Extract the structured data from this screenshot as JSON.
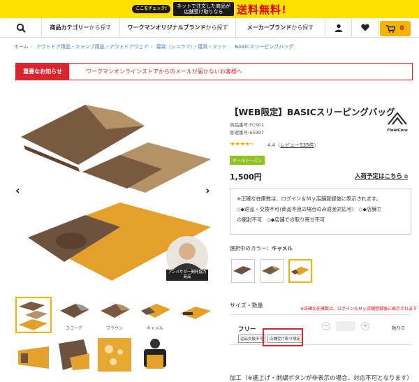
{
  "banner": {
    "check_label": "ここをチェック!",
    "middle_line1": "ネットで注文した商品が",
    "middle_line2": "店舗受け取りなら",
    "free_text": "送料無料!"
  },
  "nav": {
    "category": {
      "bold": "商品カテゴリー",
      "rest": "から探す"
    },
    "brand": {
      "bold": "ワークマンオリジナルブランド",
      "rest": "から探す"
    },
    "maker": {
      "bold": "メーカーブランド",
      "rest": "から探す"
    },
    "cart_count": "0"
  },
  "breadcrumb": [
    "ホーム",
    "アウトドア用品・キャンプ用品・アウトドアウェア",
    "寝袋（シュラフ）・寝具・マット",
    "BASICスリーピングバッグ"
  ],
  "notice": {
    "label": "重要なお知らせ",
    "text": "ワークマンオンラインストアからのメールが届かないお客様へ"
  },
  "product": {
    "title": "【WEB限定】BASICスリーピングバッグ",
    "product_no": "商品番号:FCS01",
    "manage_no": "管理番号:65997",
    "brand_name": "FieldCore",
    "rating": "4.4",
    "review_link": "レビュー535件",
    "season_badge": "オールシーズン",
    "price": "1,500円",
    "schedule_link": "入荷予定はこちら",
    "info_lines": [
      "※正確な在庫数は、ログイン＆Ｍｙ店舗登録後に表示されます。",
      "◇◆返品・交換不可(商品不良の場合のみ返金対応可)　◇◆店舗で",
      "の開封不可　◇◆店舗での取り寄せ不可"
    ],
    "color_label": "選択中のカラー：",
    "color_value": "キャメル",
    "ambassador_badge": "アンバサダー開発協力商品",
    "thumb_captions": [
      "",
      "ココーテ",
      "ブラウン",
      "キャメル",
      ""
    ],
    "size_label": "サイズ・数量",
    "stock_note": "※正確な在庫数は、ログイン＆Ｍｙ店舗登録後に表示されます",
    "size_name": "フリー",
    "tag_return": "返品交換不可",
    "tag_pickup": "店舗受け取り限定",
    "remain": "残り０",
    "processing": "加工（※裾上げ・刺繍ボタンが非表示の場合、対応不可となります）"
  },
  "colors": {
    "banner_yellow": "#ffe100",
    "alert_red": "#d9262f",
    "accent_orange": "#f5b400",
    "link_blue": "#3a78c2"
  }
}
